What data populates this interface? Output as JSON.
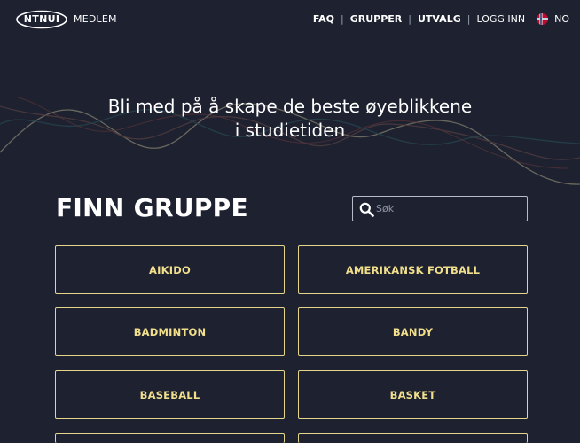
{
  "nav": {
    "logo_text": "NTNUI",
    "brand_label": "MEDLEM",
    "links": [
      "FAQ",
      "GRUPPER",
      "UTVALG",
      "LOGG INN"
    ],
    "language": "NO",
    "flag_icon": "norway-flag-icon"
  },
  "hero": {
    "title_line1": "Bli med på å skape de beste øyeblikkene",
    "title_line2": "i studietiden"
  },
  "groups_section": {
    "title": "FINN GRUPPE",
    "search_placeholder": "Søk",
    "search_icon": "search-icon",
    "groups": [
      "AIKIDO",
      "AMERIKANSK FOTBALL",
      "BADMINTON",
      "BANDY",
      "BASEBALL",
      "BASKET",
      "",
      ""
    ]
  },
  "colors": {
    "background": "#1e2130",
    "accent": "#f1df8c",
    "card_border": "#e4d48c"
  }
}
